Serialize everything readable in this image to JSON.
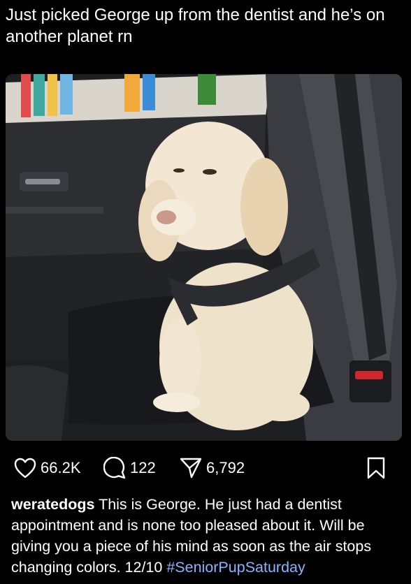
{
  "tweet": {
    "text": "Just picked George up from the dentist and he’s on another planet rn"
  },
  "photo": {
    "subject": "dog",
    "colors": {
      "dog_fur": "#f2e6d2",
      "interior": "#2a2b2f",
      "seat": "#1a1b1e"
    }
  },
  "actions": {
    "likes": {
      "icon": "heart-icon",
      "count": "66.2K"
    },
    "comments": {
      "icon": "comment-icon",
      "count": "122"
    },
    "shares": {
      "icon": "share-icon",
      "count": "6,792"
    },
    "save": {
      "icon": "bookmark-icon"
    }
  },
  "caption": {
    "username": "weratedogs",
    "body": " This is George. He just had a dentist appointment and is none too pleased about it. Will be giving you a piece of his mind as soon as the air stops changing colors. 12/10 ",
    "hashtag": "#SeniorPupSaturday"
  },
  "theme": {
    "background": "#000000",
    "text": "#ffffff",
    "link": "#8ab4ff"
  }
}
